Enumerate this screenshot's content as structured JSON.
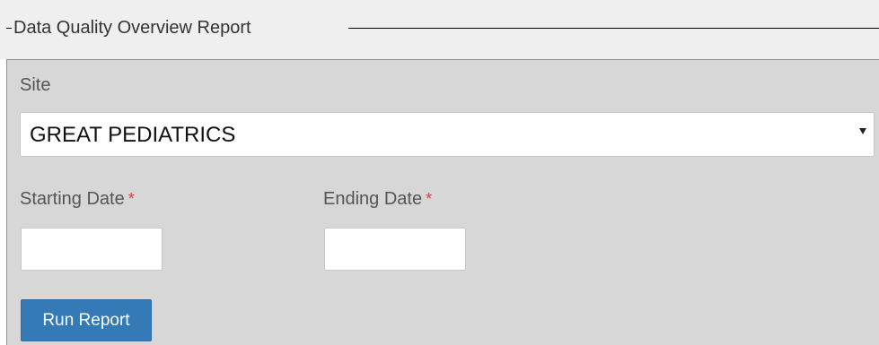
{
  "fieldset": {
    "legend": "Data Quality Overview Report"
  },
  "site": {
    "label": "Site",
    "selected": "GREAT PEDIATRICS"
  },
  "starting_date": {
    "label": "Starting Date",
    "required_marker": "*",
    "value": "",
    "placeholder": ""
  },
  "ending_date": {
    "label": "Ending Date",
    "required_marker": "*",
    "value": "",
    "placeholder": ""
  },
  "actions": {
    "run_report_label": "Run Report"
  },
  "icons": {
    "select_caret": "caret-down-icon"
  },
  "colors": {
    "panel_bg": "#d7d7d7",
    "legend_bg": "#efefef",
    "primary_button": "#337ab7",
    "required_marker": "#e0393e"
  }
}
